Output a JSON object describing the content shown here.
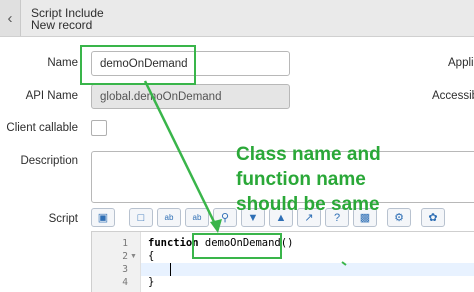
{
  "header": {
    "title": "Script Include",
    "subtitle": "New record"
  },
  "form": {
    "name_label": "Name",
    "name_value": "demoOnDemand",
    "api_name_label": "API Name",
    "api_name_value": "global.demoOnDemand",
    "client_callable_label": "Client callable",
    "client_callable_checked": false,
    "description_label": "Description",
    "description_value": "",
    "script_label": "Script",
    "application_label": "Appli",
    "accessible_label": "Accessibl"
  },
  "toolbar": {
    "buttons": [
      "comment-icon",
      "format-icon",
      "find-replace-icon",
      "replace-all-icon",
      "search-icon",
      "down-icon",
      "up-icon",
      "fullscreen-icon",
      "help-icon",
      "save-icon",
      "toggle-icon",
      "debug-icon"
    ]
  },
  "editor": {
    "lines": [
      {
        "number": "1",
        "code": "function demoOnDemand()"
      },
      {
        "number": "2",
        "code": "{"
      },
      {
        "number": "3",
        "code": ""
      },
      {
        "number": "4",
        "code": "}"
      }
    ]
  },
  "annotation": {
    "line1": "Class name and",
    "line2": "function name",
    "line3": "should be same",
    "color": "#2aa838"
  }
}
